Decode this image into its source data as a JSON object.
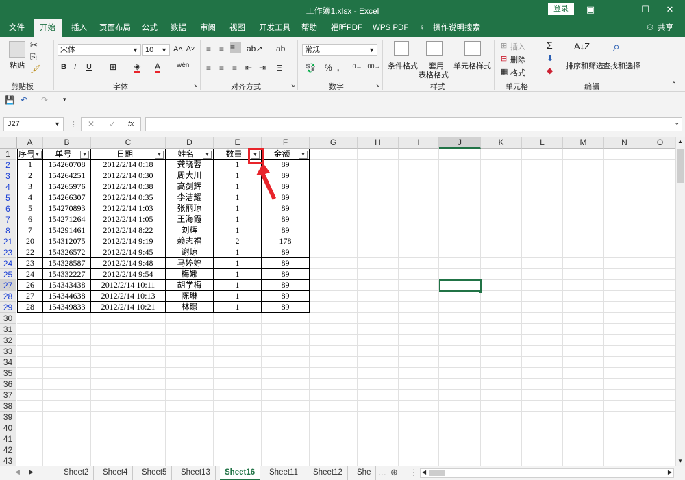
{
  "window": {
    "title": "工作簿1.xlsx  -  Excel",
    "login": "登录",
    "share": "共享"
  },
  "menu": {
    "tabs": [
      "文件",
      "开始",
      "插入",
      "页面布局",
      "公式",
      "数据",
      "审阅",
      "视图",
      "开发工具",
      "帮助",
      "福昕PDF",
      "WPS PDF",
      "操作说明搜索"
    ],
    "active": "开始"
  },
  "ribbon": {
    "paste": "粘贴",
    "groups": {
      "clipboard": "剪贴板",
      "font": "字体",
      "align": "对齐方式",
      "number": "数字",
      "styles": "样式",
      "cells": "单元格",
      "edit": "编辑"
    },
    "font_name": "宋体",
    "font_size": "10",
    "number_format": "常规",
    "cond_format": "条件格式",
    "table_format_1": "套用",
    "table_format_2": "表格格式",
    "cell_style": "单元格样式",
    "insert": "插入",
    "delete": "删除",
    "format": "格式",
    "sort_filter": "排序和筛选",
    "find_select": "查找和选择"
  },
  "formula_bar": {
    "name_box": "J27",
    "fx": "fx",
    "value": ""
  },
  "grid": {
    "columns": [
      "A",
      "B",
      "C",
      "D",
      "E",
      "F",
      "G",
      "H",
      "I",
      "J",
      "K",
      "L",
      "M",
      "N",
      "O"
    ],
    "header": [
      "序号",
      "单号",
      "日期",
      "姓名",
      "数量",
      "金额"
    ],
    "rows": [
      {
        "n": "2",
        "cells": [
          "1",
          "154260708",
          "2012/2/14 0:18",
          "龚晓蓉",
          "1",
          "89"
        ]
      },
      {
        "n": "3",
        "cells": [
          "2",
          "154264251",
          "2012/2/14 0:30",
          "周大川",
          "1",
          "89"
        ]
      },
      {
        "n": "4",
        "cells": [
          "3",
          "154265976",
          "2012/2/14 0:38",
          "高剑辉",
          "1",
          "89"
        ]
      },
      {
        "n": "5",
        "cells": [
          "4",
          "154266307",
          "2012/2/14 0:35",
          "李洁耀",
          "1",
          "89"
        ]
      },
      {
        "n": "6",
        "cells": [
          "5",
          "154270893",
          "2012/2/14 1:03",
          "张丽琼",
          "1",
          "89"
        ]
      },
      {
        "n": "7",
        "cells": [
          "6",
          "154271264",
          "2012/2/14 1:05",
          "王海霞",
          "1",
          "89"
        ]
      },
      {
        "n": "8",
        "cells": [
          "7",
          "154291461",
          "2012/2/14 8:22",
          "刘辉",
          "1",
          "89"
        ]
      },
      {
        "n": "21",
        "cells": [
          "20",
          "154312075",
          "2012/2/14 9:19",
          "赖志福",
          "2",
          "178"
        ]
      },
      {
        "n": "23",
        "cells": [
          "22",
          "154326572",
          "2012/2/14 9:45",
          "谢琼",
          "1",
          "89"
        ]
      },
      {
        "n": "24",
        "cells": [
          "23",
          "154328587",
          "2012/2/14 9:48",
          "马婷婷",
          "1",
          "89"
        ]
      },
      {
        "n": "25",
        "cells": [
          "24",
          "154332227",
          "2012/2/14 9:54",
          "梅娜",
          "1",
          "89"
        ]
      },
      {
        "n": "27",
        "cells": [
          "26",
          "154343438",
          "2012/2/14 10:11",
          "胡学梅",
          "1",
          "89"
        ]
      },
      {
        "n": "28",
        "cells": [
          "27",
          "154344638",
          "2012/2/14 10:13",
          "陈琳",
          "1",
          "89"
        ]
      },
      {
        "n": "29",
        "cells": [
          "28",
          "154349833",
          "2012/2/14 10:21",
          "林璟",
          "1",
          "89"
        ]
      }
    ],
    "empty_rows": [
      "30",
      "31",
      "32",
      "33",
      "34",
      "35",
      "36",
      "37",
      "38",
      "39",
      "40",
      "41",
      "42",
      "43"
    ]
  },
  "sheets": {
    "tabs": [
      "Sheet2",
      "Sheet4",
      "Sheet5",
      "Sheet13",
      "Sheet16",
      "Sheet11",
      "Sheet12",
      "She"
    ],
    "active": "Sheet16"
  },
  "colors": {
    "accent": "#217346",
    "highlight": "#e8242b",
    "filtered_row": "#1a3fd6"
  }
}
